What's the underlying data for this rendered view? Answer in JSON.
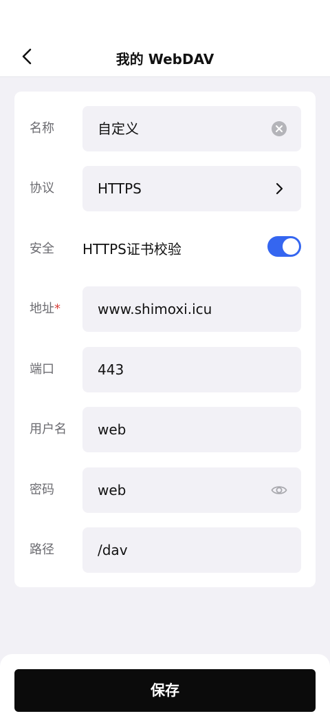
{
  "header": {
    "title": "我的 WebDAV",
    "back_icon": "chevron-left-icon"
  },
  "form": {
    "name": {
      "label": "名称",
      "value": "自定义",
      "icon": "clear-circle-icon"
    },
    "protocol": {
      "label": "协议",
      "value": "HTTPS",
      "icon": "chevron-right-icon"
    },
    "security": {
      "label": "安全",
      "text": "HTTPS证书校验",
      "enabled": true
    },
    "address": {
      "label": "地址",
      "required_mark": "*",
      "value": "www.shimoxi.icu"
    },
    "port": {
      "label": "端口",
      "value": "443"
    },
    "username": {
      "label": "用户名",
      "value": "web"
    },
    "password": {
      "label": "密码",
      "value": "web",
      "icon": "eye-icon"
    },
    "path": {
      "label": "路径",
      "value": "/dav"
    }
  },
  "footer": {
    "save_label": "保存"
  },
  "colors": {
    "accent": "#3566f0",
    "background": "#f2f1f6",
    "required": "#d9413b",
    "button": "#0b0b0b"
  }
}
